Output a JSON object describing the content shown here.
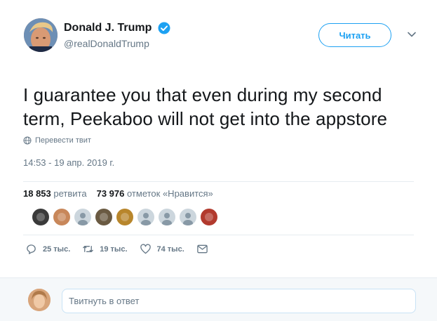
{
  "author": {
    "display_name": "Donald J. Trump",
    "handle": "@realDonaldTrump",
    "verified": true,
    "avatar_icon": "profile-photo"
  },
  "follow_button": {
    "label": "Читать"
  },
  "menu_icon": "chevron-down-icon",
  "tweet": {
    "text": "I guarantee you that even during my second term, Peekaboo will not get into the appstore",
    "translate_label": "Перевести твит",
    "timestamp": "14:53 - 19 апр. 2019 г."
  },
  "stats": {
    "retweets_count": "18 853",
    "retweets_label": "ретвита",
    "likes_count": "73 976",
    "likes_label": "отметок «Нравится»"
  },
  "likers": [
    {
      "icon": "liker-avatar",
      "color": "#3a3a3a"
    },
    {
      "icon": "liker-avatar",
      "color": "#c8875a"
    },
    {
      "icon": "default-avatar",
      "color": "#aab8c2"
    },
    {
      "icon": "liker-avatar",
      "color": "#6a5a42"
    },
    {
      "icon": "liker-avatar",
      "color": "#b8862c"
    },
    {
      "icon": "default-avatar",
      "color": "#aab8c2"
    },
    {
      "icon": "default-avatar",
      "color": "#aab8c2"
    },
    {
      "icon": "default-avatar",
      "color": "#aab8c2"
    },
    {
      "icon": "liker-avatar",
      "color": "#b23a2e"
    }
  ],
  "actions": {
    "reply_count": "25 тыс.",
    "retweet_count": "19 тыс.",
    "like_count": "74 тыс."
  },
  "reply": {
    "placeholder": "Твитнуть в ответ"
  },
  "colors": {
    "accent": "#1da1f2",
    "secondary_text": "#657786",
    "divider": "#e6ecf0"
  }
}
